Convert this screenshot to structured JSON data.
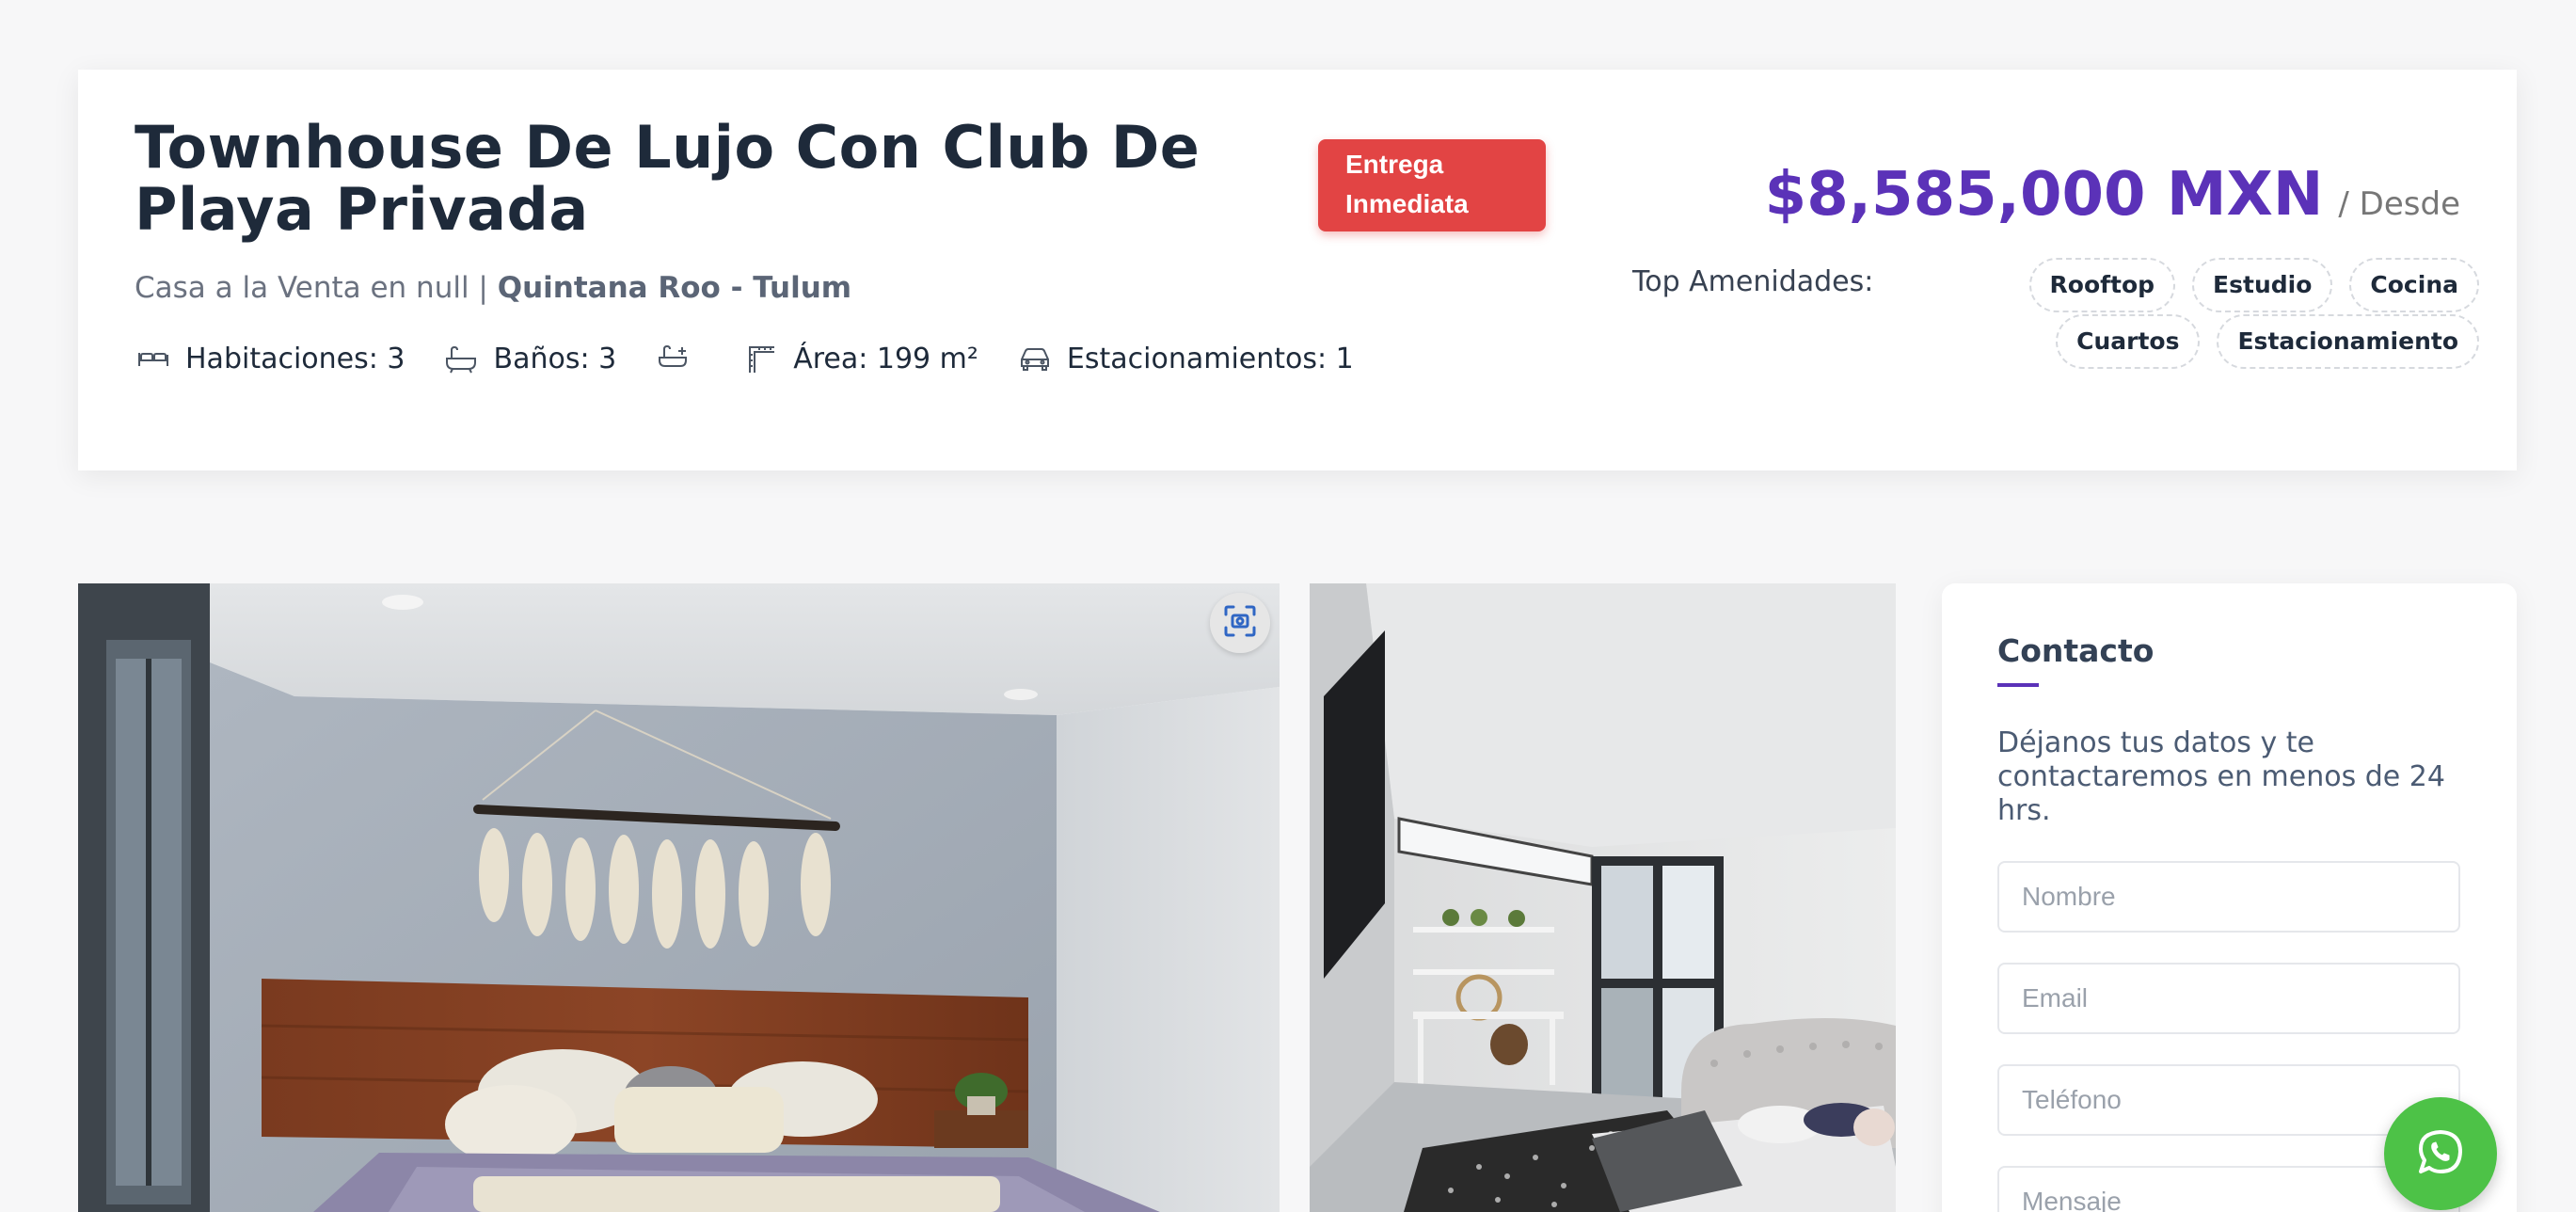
{
  "header": {
    "title": "Townhouse De Lujo Con Club De Playa Privada",
    "badge": "Entrega Inmediata",
    "subtitle_prefix": "Casa a la Venta en null | ",
    "location": "Quintana Roo - Tulum",
    "features": [
      {
        "icon": "bed-icon",
        "label": "Habitaciones: 3"
      },
      {
        "icon": "bathtub-icon",
        "label": "Baños: 3"
      },
      {
        "icon": "half-bath-icon",
        "label": ""
      },
      {
        "icon": "area-icon",
        "label": "Área: 199 m²"
      },
      {
        "icon": "car-icon",
        "label": "Estacionamientos: 1"
      }
    ],
    "price": "$8,585,000 MXN",
    "price_suffix": "/ Desde",
    "amenities_label": "Top Amenidades:",
    "amenities": [
      "Rooftop",
      "Estudio",
      "Cocina",
      "Cuartos",
      "Estacionamiento"
    ]
  },
  "gallery": {
    "main_icon": "expand-scan-icon"
  },
  "contact": {
    "title": "Contacto",
    "description": "Déjanos tus datos y te contactaremos en menos de 24 hrs.",
    "fields": {
      "name_placeholder": "Nombre",
      "email_placeholder": "Email",
      "phone_placeholder": "Teléfono",
      "message_placeholder": "Mensaje"
    }
  },
  "whatsapp": {
    "icon": "whatsapp-icon"
  },
  "colors": {
    "accent": "#5b32b8",
    "badge": "#e24444",
    "whatsapp": "#4dc247"
  }
}
